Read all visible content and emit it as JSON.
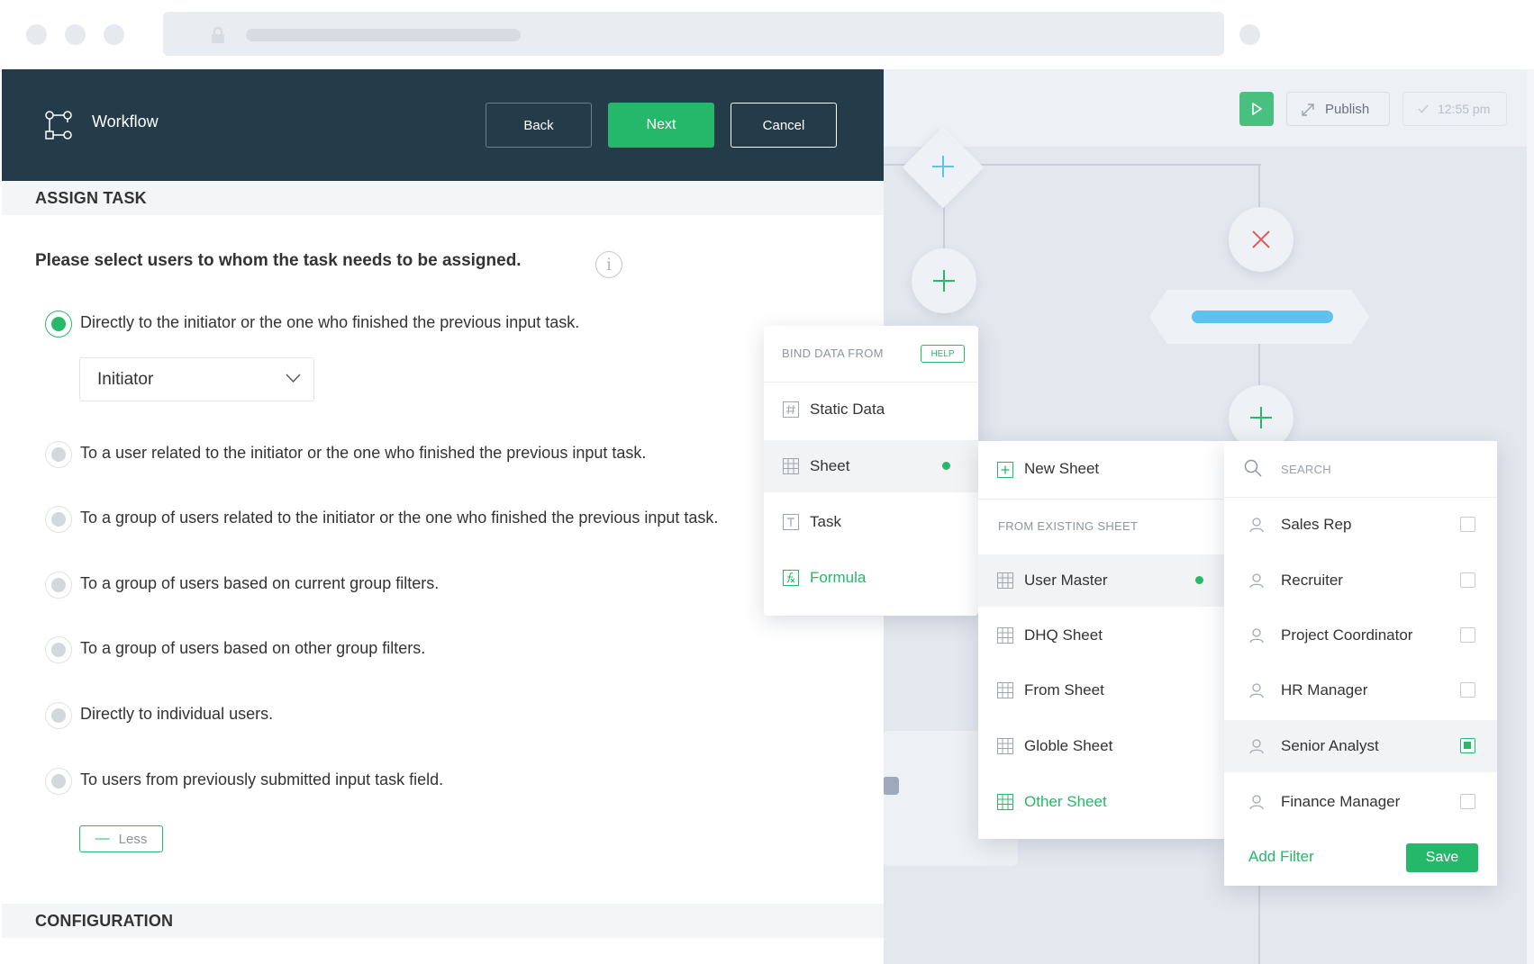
{
  "header": {
    "title": "Workflow",
    "back_label": "Back",
    "next_label": "Next",
    "cancel_label": "Cancel"
  },
  "toolbar": {
    "publish_label": "Publish",
    "time_label": "12:55 pm"
  },
  "sections": {
    "assign_task": "ASSIGN TASK",
    "configuration": "CONFIGURATION"
  },
  "question": "Please select users to whom the task needs to be assigned.",
  "options": [
    {
      "label": "Directly to the initiator or the one who finished the previous input task.",
      "selected": true
    },
    {
      "label": "To a user related to the initiator or the one who finished the previous input task.",
      "selected": false
    },
    {
      "label": "To a group of users related to the initiator or the one who finished the previous input task.",
      "selected": false
    },
    {
      "label": "To a group of users based on current group filters.",
      "selected": false
    },
    {
      "label": "To a group of users based on other group filters.",
      "selected": false
    },
    {
      "label": "Directly to individual users.",
      "selected": false
    },
    {
      "label": "To users from previously submitted input task field.",
      "selected": false
    }
  ],
  "initiator_select": {
    "value": "Initiator"
  },
  "less_label": "Less",
  "bind_menu": {
    "caption": "BIND DATA FROM",
    "help_label": "HELP",
    "items": [
      {
        "label": "Static Data",
        "icon": "hash-icon"
      },
      {
        "label": "Sheet",
        "icon": "table-icon"
      },
      {
        "label": "Task",
        "icon": "text-box-icon"
      },
      {
        "label": "Formula",
        "icon": "formula-icon"
      }
    ]
  },
  "sheet_menu": {
    "new_sheet_label": "New Sheet",
    "caption": "FROM EXISTING SHEET",
    "items": [
      {
        "label": "User Master"
      },
      {
        "label": "DHQ Sheet"
      },
      {
        "label": "From Sheet"
      },
      {
        "label": "Globle Sheet"
      },
      {
        "label": "Other Sheet"
      }
    ]
  },
  "user_menu": {
    "search_placeholder": "SEARCH",
    "items": [
      {
        "label": "Sales Rep",
        "checked": false
      },
      {
        "label": "Recruiter",
        "checked": false
      },
      {
        "label": "Project Coordinator",
        "checked": false
      },
      {
        "label": "HR Manager",
        "checked": false
      },
      {
        "label": "Senior Analyst",
        "checked": true
      },
      {
        "label": "Finance Manager",
        "checked": false
      }
    ],
    "add_filter_label": "Add Filter",
    "save_label": "Save"
  },
  "colors": {
    "accent_green": "#25b86a",
    "header_bg": "#243b4a",
    "flow_blue": "#5ec1ee",
    "error_red": "#e05a5a"
  }
}
